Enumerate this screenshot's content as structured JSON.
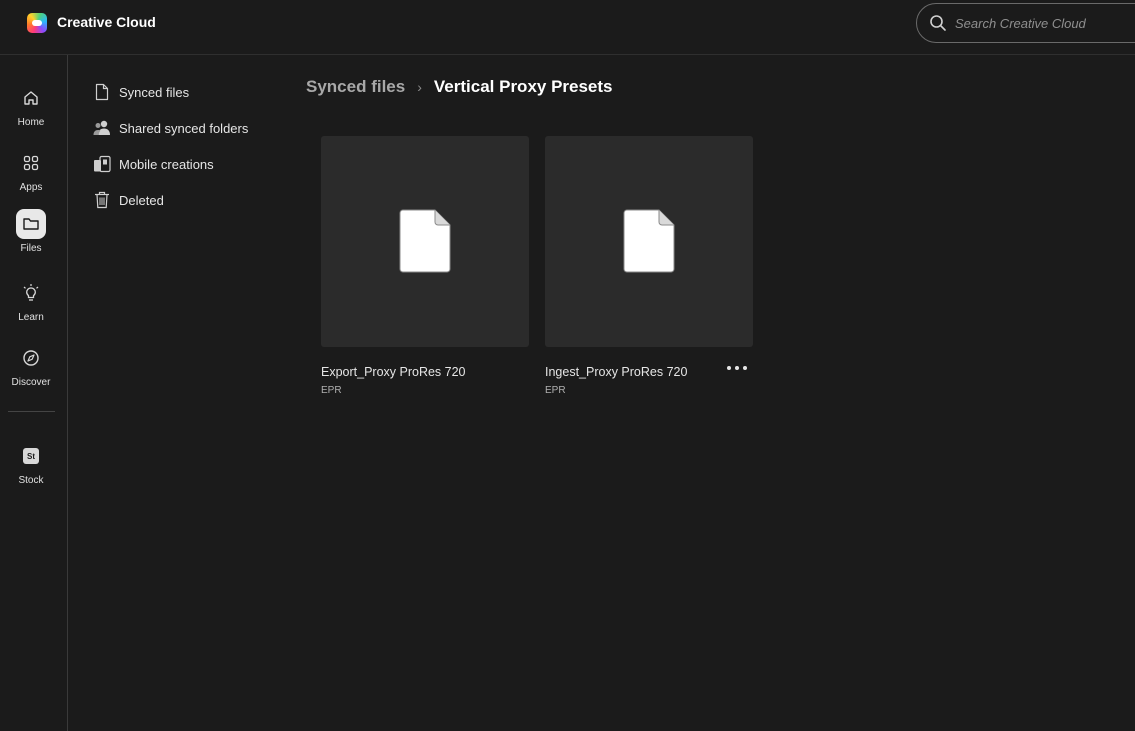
{
  "app": {
    "title": "Creative Cloud"
  },
  "search": {
    "placeholder": "Search Creative Cloud"
  },
  "rail": {
    "items": [
      {
        "label": "Home",
        "icon": "home-icon"
      },
      {
        "label": "Apps",
        "icon": "apps-grid-icon"
      },
      {
        "label": "Files",
        "icon": "folder-icon",
        "active": true
      },
      {
        "label": "Learn",
        "icon": "lightbulb-icon"
      },
      {
        "label": "Discover",
        "icon": "compass-icon"
      },
      {
        "label": "Stock",
        "icon": "stock-icon",
        "icon_text": "St"
      }
    ]
  },
  "subnav": {
    "items": [
      {
        "label": "Synced files",
        "icon": "document-icon"
      },
      {
        "label": "Shared synced folders",
        "icon": "people-icon"
      },
      {
        "label": "Mobile creations",
        "icon": "devices-icon"
      },
      {
        "label": "Deleted",
        "icon": "trash-icon"
      }
    ]
  },
  "breadcrumb": {
    "parent": "Synced files",
    "separator": "›",
    "current": "Vertical Proxy Presets"
  },
  "files": [
    {
      "name": "Export_Proxy ProRes 720",
      "type": "EPR"
    },
    {
      "name": "Ingest_Proxy ProRes 720",
      "type": "EPR",
      "show_more": true
    }
  ],
  "colors": {
    "background": "#1b1b1b",
    "card": "#2b2b2b",
    "active_rail": "#e8e8e8"
  }
}
